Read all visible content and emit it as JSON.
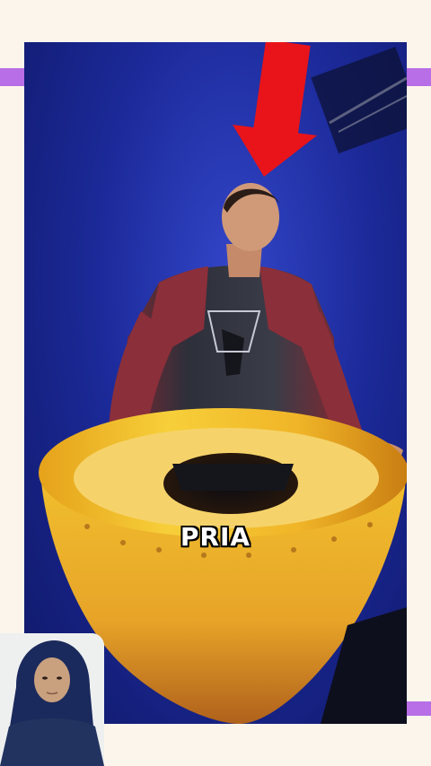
{
  "caption": {
    "text": "PRIA"
  },
  "colors": {
    "background": "#fbf5ec",
    "accent": "#b86ee6",
    "arrow": "#e8141a",
    "stage_blue": "#1c2a9a",
    "cone_yellow": "#f2c12e"
  },
  "icons": {
    "down_arrow": "arrow-down-icon"
  }
}
